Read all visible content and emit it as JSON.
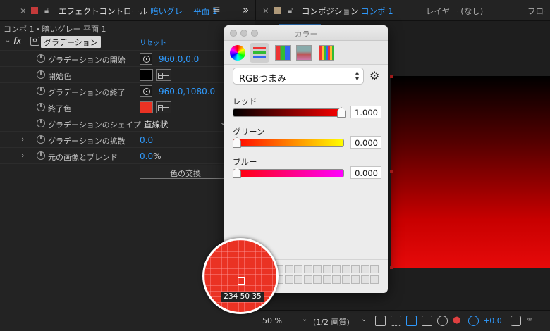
{
  "top": {
    "effect_tab": "エフェクトコントロール",
    "effect_tab_layer": "暗いグレー 平面 1",
    "menu_icon": "≡",
    "expand": "»",
    "comp_tab": "コンポジション",
    "comp_tab_name": "コンポ 1",
    "layer_tab": "レイヤー (なし)",
    "flow_tab": "フロー"
  },
  "effect": {
    "breadcrumb": "コンポ 1・暗いグレー 平面 1",
    "fx_label": "fx",
    "effect_name": "グラデーション",
    "reset": "リセット",
    "rows": [
      {
        "label": "グラデーションの開始",
        "value": "960.0,0.0"
      },
      {
        "label": "開始色",
        "color": "#000000"
      },
      {
        "label": "グラデーションの終了",
        "value": "960.0,1080.0"
      },
      {
        "label": "終了色",
        "color": "#ea3223"
      },
      {
        "label": "グラデーションのシェイプ",
        "dropdown": "直線状"
      },
      {
        "label": "グラデーションの拡散",
        "value": "0.0"
      },
      {
        "label": "元の画像とブレンド",
        "value": "0.0",
        "unit": "%"
      }
    ],
    "swap_button": "色の交換"
  },
  "color_window": {
    "title": "カラー",
    "mode": "RGBつまみ",
    "sliders": [
      {
        "label": "レッド",
        "value": "1.000",
        "fraction": 1.0,
        "gradient": "linear-gradient(90deg,#000,#ff0000)"
      },
      {
        "label": "グリーン",
        "value": "0.000",
        "fraction": 0.0,
        "gradient": "linear-gradient(90deg,#ff0000,#ffff00)"
      },
      {
        "label": "ブルー",
        "value": "0.000",
        "fraction": 0.0,
        "gradient": "linear-gradient(90deg,#ff0000,#ff00ff)"
      }
    ]
  },
  "loupe": {
    "rgb": "234 50 35"
  },
  "bottom": {
    "zoom": "50 %",
    "quality": "(1/2 画質)",
    "exposure": "+0.0"
  },
  "colors": {
    "accent": "#2f9bff",
    "end_color": "#ea3223"
  }
}
